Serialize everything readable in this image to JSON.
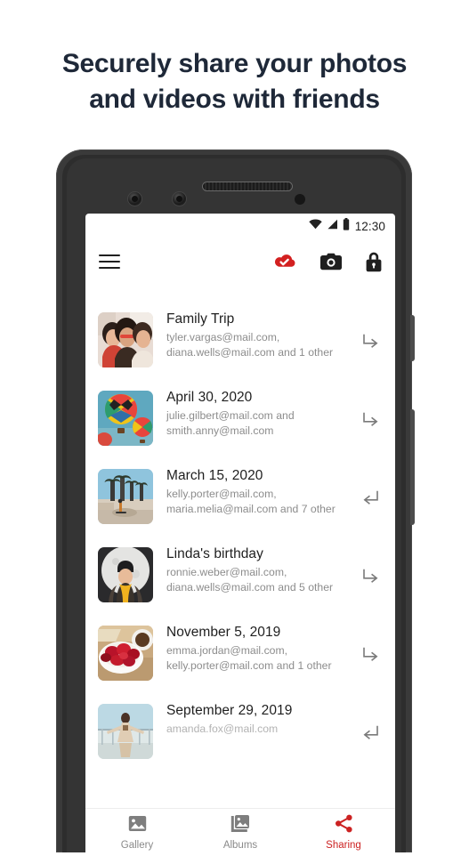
{
  "headline": {
    "line1": "Securely share your photos",
    "line2": "and videos with friends"
  },
  "colors": {
    "headline": "#1e2838",
    "accent_red": "#cc2222",
    "cloud_red": "#d32020",
    "title": "#1f1f1f",
    "subtitle": "#8c8c8c",
    "nav_inactive": "#8a8a8a"
  },
  "phone": {
    "status_bar": {
      "time": "12:30",
      "icons": [
        "wifi-icon",
        "signal-icon",
        "battery-icon"
      ]
    },
    "toolbar": {
      "menu_icon": "hamburger-menu-icon",
      "actions": [
        {
          "icon": "cloud-check-icon",
          "color": "#d32020"
        },
        {
          "icon": "camera-icon",
          "color": "#1f1f1f"
        },
        {
          "icon": "lock-icon",
          "color": "#1f1f1f"
        }
      ]
    },
    "sharing_list": [
      {
        "title": "Family Trip",
        "recipients_line1": "tyler.vargas@mail.com,",
        "recipients_line2": "diana.wells@mail.com and 1 other",
        "direction": "outgoing",
        "arrow_icon": "arrow-outgoing-icon",
        "thumbnail": "three-friends-selfie"
      },
      {
        "title": "April 30, 2020",
        "recipients_line1": "julie.gilbert@mail.com and",
        "recipients_line2": "smith.anny@mail.com",
        "direction": "outgoing",
        "arrow_icon": "arrow-outgoing-icon",
        "thumbnail": "hot-air-balloons"
      },
      {
        "title": "March 15, 2020",
        "recipients_line1": "kelly.porter@mail.com,",
        "recipients_line2": "maria.melia@mail.com and 7 other",
        "direction": "incoming",
        "arrow_icon": "arrow-incoming-icon",
        "thumbnail": "skate-park-palms"
      },
      {
        "title": "Linda's birthday",
        "recipients_line1": "ronnie.weber@mail.com,",
        "recipients_line2": "diana.wells@mail.com and 5 other",
        "direction": "outgoing",
        "arrow_icon": "arrow-outgoing-icon",
        "thumbnail": "woman-beanie-moon-mural"
      },
      {
        "title": "November 5,  2019",
        "recipients_line1": "emma.jordan@mail.com,",
        "recipients_line2": "kelly.porter@mail.com and 1 other",
        "direction": "outgoing",
        "arrow_icon": "arrow-outgoing-icon",
        "thumbnail": "strawberry-bowl-coffee"
      },
      {
        "title": "September 29,  2019",
        "recipients_line1": "amanda.fox@mail.com",
        "recipients_line2": "",
        "direction": "incoming",
        "arrow_icon": "arrow-incoming-icon",
        "thumbnail": "person-on-pier"
      }
    ],
    "bottom_nav": [
      {
        "label": "Gallery",
        "icon": "image-icon",
        "active": false
      },
      {
        "label": "Albums",
        "icon": "albums-icon",
        "active": false
      },
      {
        "label": "Sharing",
        "icon": "share-icon",
        "active": true
      }
    ]
  }
}
